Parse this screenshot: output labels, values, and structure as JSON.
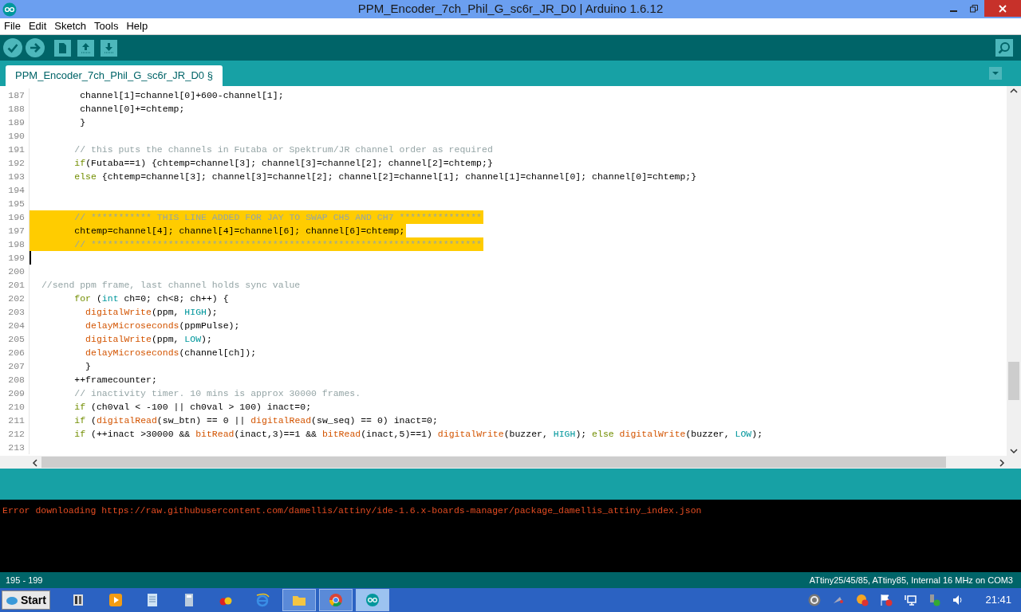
{
  "window": {
    "title": "PPM_Encoder_7ch_Phil_G_sc6r_JR_D0 | Arduino 1.6.12"
  },
  "menu": [
    "File",
    "Edit",
    "Sketch",
    "Tools",
    "Help"
  ],
  "tabs": [
    {
      "label": "PPM_Encoder_7ch_Phil_G_sc6r_JR_D0 §",
      "selected": true
    }
  ],
  "editor": {
    "lines": [
      {
        "number": "187",
        "selected": false,
        "caret": false,
        "tokens": [
          {
            "kind": "plain",
            "text": "        channel[1]=channel[0]+600-channel[1];"
          }
        ]
      },
      {
        "number": "188",
        "selected": false,
        "caret": false,
        "tokens": [
          {
            "kind": "plain",
            "text": "        channel[0]+=chtemp;"
          }
        ]
      },
      {
        "number": "189",
        "selected": false,
        "caret": false,
        "tokens": [
          {
            "kind": "plain",
            "text": "        }"
          }
        ]
      },
      {
        "number": "190",
        "selected": false,
        "caret": false
      },
      {
        "number": "191",
        "selected": false,
        "caret": false,
        "tokens": [
          {
            "kind": "comment",
            "text": "       // this puts the channels in Futaba or Spektrum/JR channel order as required"
          }
        ]
      },
      {
        "number": "192",
        "selected": false,
        "caret": false,
        "tokens": [
          {
            "kind": "keyword",
            "text": "       if"
          },
          {
            "kind": "plain",
            "text": "(Futaba==1) {chtemp=channel[3]; channel[3]=channel[2]; channel[2]=chtemp;}"
          }
        ]
      },
      {
        "number": "193",
        "selected": false,
        "caret": false,
        "tokens": [
          {
            "kind": "keyword",
            "text": "       else"
          },
          {
            "kind": "plain",
            "text": " {chtemp=channel[3]; channel[3]=channel[2]; channel[2]=channel[1]; channel[1]=channel[0]; channel[0]=chtemp;}"
          }
        ]
      },
      {
        "number": "194",
        "selected": false,
        "caret": false
      },
      {
        "number": "195",
        "selected": false,
        "caret": false
      },
      {
        "number": "196",
        "selected": true,
        "caret": false,
        "tokens": [
          {
            "kind": "comment",
            "text": "       // *********** THIS LINE ADDED FOR JAY TO SWAP CH5 AND CH7 ***************"
          }
        ]
      },
      {
        "number": "197",
        "selected": true,
        "caret": false,
        "tokens": [
          {
            "kind": "plain",
            "text": "       chtemp=channel[4]; channel[4]=channel[6]; channel[6]=chtemp;"
          }
        ]
      },
      {
        "number": "198",
        "selected": true,
        "caret": false,
        "tokens": [
          {
            "kind": "comment",
            "text": "       // ***********************************************************************"
          }
        ]
      },
      {
        "number": "199",
        "selected": false,
        "caret": true
      },
      {
        "number": "200",
        "selected": false,
        "caret": false
      },
      {
        "number": "201",
        "selected": false,
        "caret": false,
        "tokens": [
          {
            "kind": "comment",
            "text": " //send ppm frame, last channel holds sync value"
          }
        ]
      },
      {
        "number": "202",
        "selected": false,
        "caret": false,
        "tokens": [
          {
            "kind": "keyword",
            "text": "       for"
          },
          {
            "kind": "plain",
            "text": " ("
          },
          {
            "kind": "constant",
            "text": "int"
          },
          {
            "kind": "plain",
            "text": " ch=0; ch<8; ch++) {"
          }
        ]
      },
      {
        "number": "203",
        "selected": false,
        "caret": false,
        "tokens": [
          {
            "kind": "function",
            "text": "         digitalWrite"
          },
          {
            "kind": "plain",
            "text": "(ppm, "
          },
          {
            "kind": "constant",
            "text": "HIGH"
          },
          {
            "kind": "plain",
            "text": ");"
          }
        ]
      },
      {
        "number": "204",
        "selected": false,
        "caret": false,
        "tokens": [
          {
            "kind": "function",
            "text": "         delayMicroseconds"
          },
          {
            "kind": "plain",
            "text": "(ppmPulse);"
          }
        ]
      },
      {
        "number": "205",
        "selected": false,
        "caret": false,
        "tokens": [
          {
            "kind": "function",
            "text": "         digitalWrite"
          },
          {
            "kind": "plain",
            "text": "(ppm, "
          },
          {
            "kind": "constant",
            "text": "LOW"
          },
          {
            "kind": "plain",
            "text": ");"
          }
        ]
      },
      {
        "number": "206",
        "selected": false,
        "caret": false,
        "tokens": [
          {
            "kind": "function",
            "text": "         delayMicroseconds"
          },
          {
            "kind": "plain",
            "text": "(channel[ch]);"
          }
        ]
      },
      {
        "number": "207",
        "selected": false,
        "caret": false,
        "tokens": [
          {
            "kind": "plain",
            "text": "         }"
          }
        ]
      },
      {
        "number": "208",
        "selected": false,
        "caret": false,
        "tokens": [
          {
            "kind": "plain",
            "text": "       ++framecounter;"
          }
        ]
      },
      {
        "number": "209",
        "selected": false,
        "caret": false,
        "tokens": [
          {
            "kind": "comment",
            "text": "       // inactivity timer. 10 mins is approx 30000 frames."
          }
        ]
      },
      {
        "number": "210",
        "selected": false,
        "caret": false,
        "tokens": [
          {
            "kind": "keyword",
            "text": "       if"
          },
          {
            "kind": "plain",
            "text": " (ch0val < -100 || ch0val > 100) inact=0;"
          }
        ]
      },
      {
        "number": "211",
        "selected": false,
        "caret": false,
        "tokens": [
          {
            "kind": "keyword",
            "text": "       if"
          },
          {
            "kind": "plain",
            "text": " ("
          },
          {
            "kind": "function",
            "text": "digitalRead"
          },
          {
            "kind": "plain",
            "text": "(sw_btn) == 0 || "
          },
          {
            "kind": "function",
            "text": "digitalRead"
          },
          {
            "kind": "plain",
            "text": "(sw_seq) == 0) inact=0;"
          }
        ]
      },
      {
        "number": "212",
        "selected": false,
        "caret": false,
        "tokens": [
          {
            "kind": "keyword",
            "text": "       if"
          },
          {
            "kind": "plain",
            "text": " (++inact >30000 && "
          },
          {
            "kind": "function",
            "text": "bitRead"
          },
          {
            "kind": "plain",
            "text": "(inact,3)==1 && "
          },
          {
            "kind": "function",
            "text": "bitRead"
          },
          {
            "kind": "plain",
            "text": "(inact,5)==1) "
          },
          {
            "kind": "function",
            "text": "digitalWrite"
          },
          {
            "kind": "plain",
            "text": "(buzzer, "
          },
          {
            "kind": "constant",
            "text": "HIGH"
          },
          {
            "kind": "plain",
            "text": "); "
          },
          {
            "kind": "keyword",
            "text": "else"
          },
          {
            "kind": "function",
            "text": " digitalWrite"
          },
          {
            "kind": "plain",
            "text": "(buzzer, "
          },
          {
            "kind": "constant",
            "text": "LOW"
          },
          {
            "kind": "plain",
            "text": ");"
          }
        ]
      },
      {
        "number": "213",
        "selected": false,
        "caret": false
      }
    ]
  },
  "console": {
    "lines": [
      {
        "kind": "error",
        "text": "Error downloading https://raw.githubusercontent.com/damellis/attiny/ide-1.6.x-boards-manager/package_damellis_attiny_index.json"
      }
    ]
  },
  "status_bar": {
    "selection": "195 - 199",
    "board": "ATtiny25/45/85, ATtiny85, Internal 16 MHz on COM3"
  },
  "taskbar": {
    "start": "Start",
    "clock": "21:41",
    "apps": [
      {
        "kind": "panel",
        "open": false,
        "selected": false
      },
      {
        "kind": "media",
        "open": false,
        "selected": false
      },
      {
        "kind": "notepad",
        "open": false,
        "selected": false
      },
      {
        "kind": "calculator",
        "open": false,
        "selected": false
      },
      {
        "kind": "bugs",
        "open": false,
        "selected": false
      },
      {
        "kind": "browser",
        "open": false,
        "selected": false
      },
      {
        "kind": "folder",
        "open": true,
        "selected": false
      },
      {
        "kind": "chrome",
        "open": true,
        "selected": false
      },
      {
        "kind": "arduino",
        "open": true,
        "selected": true
      }
    ]
  }
}
